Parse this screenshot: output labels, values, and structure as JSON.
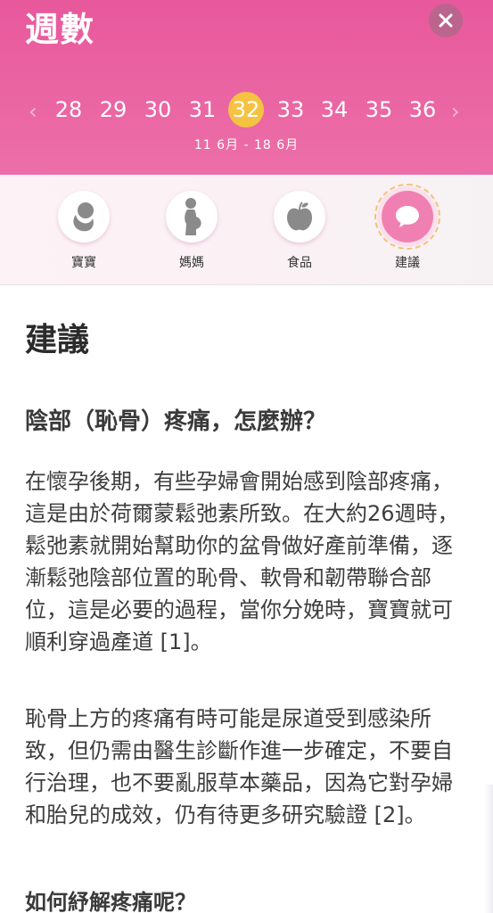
{
  "header": {
    "title": "週數",
    "close_icon": "close-icon",
    "weeks": [
      "28",
      "29",
      "30",
      "31",
      "32",
      "33",
      "34",
      "35",
      "36"
    ],
    "selected_week": "32",
    "date_range": "11 6月 - 18 6月",
    "colors": {
      "background": "#e8589c",
      "selected_week": "#f6c242"
    }
  },
  "tabs": [
    {
      "label": "寶寶",
      "icon": "baby-icon"
    },
    {
      "label": "媽媽",
      "icon": "pregnant-mother-icon"
    },
    {
      "label": "食品",
      "icon": "apple-icon"
    },
    {
      "label": "建議",
      "icon": "chat-bubble-icon",
      "active": true
    }
  ],
  "article": {
    "section_title": "建議",
    "question1": "陰部（恥骨）疼痛，怎麼辦？",
    "paragraph1": "在懷孕後期，有些孕婦會開始感到陰部疼痛，這是由於荷爾蒙鬆弛素所致。在大約26週時，鬆弛素就開始幫助你的盆骨做好產前準備，逐漸鬆弛陰部位置的恥骨、軟骨和韌帶聯合部位，這是必要的過程，當你分娩時，寶寶就可順利穿過產道 [1]。",
    "paragraph2": "恥骨上方的疼痛有時可能是尿道受到感染所致，但仍需由醫生診斷作進一步確定，不要自行治理，也不要亂服草本藥品，因為它對孕婦和胎兒的成效，仍有待更多研究驗證 [2]。",
    "question2": "如何紓解疼痛呢？"
  }
}
